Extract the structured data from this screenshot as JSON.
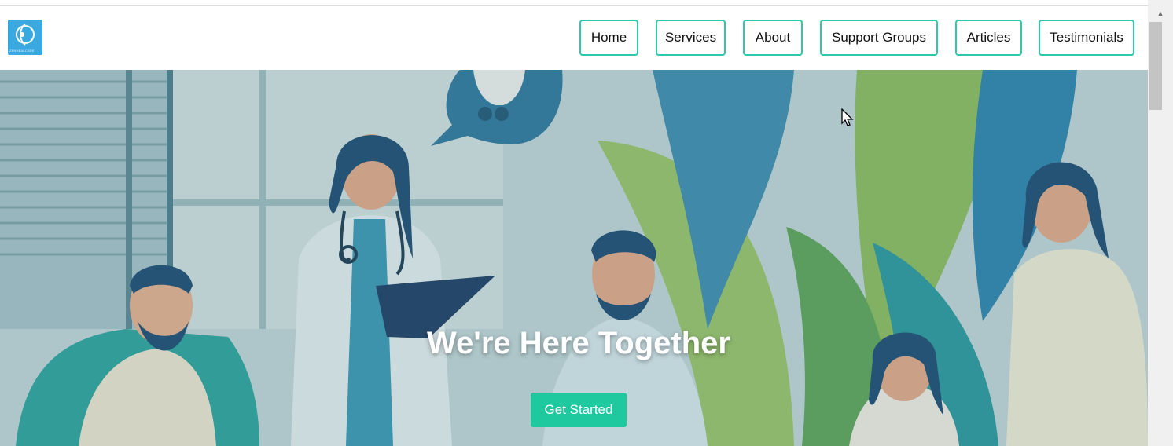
{
  "logo": {
    "text": "ZENHEALCARE"
  },
  "nav": {
    "items": [
      {
        "label": "Home"
      },
      {
        "label": "Services"
      },
      {
        "label": "About"
      },
      {
        "label": "Support Groups"
      },
      {
        "label": "Articles"
      },
      {
        "label": "Testimonials"
      }
    ]
  },
  "hero": {
    "title": "We're Here Together",
    "cta_label": "Get Started"
  },
  "colors": {
    "accent": "#2ec9a9",
    "cta": "#1fc9a0"
  }
}
